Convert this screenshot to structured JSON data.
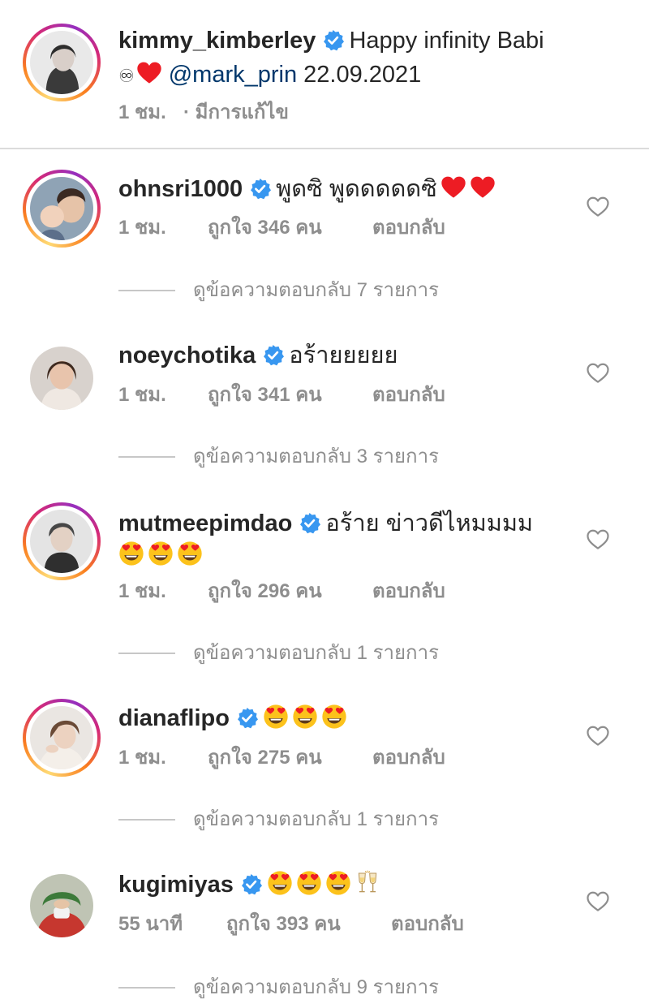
{
  "caption": {
    "username": "kimmy_kimberley",
    "text_line1": "Happy infinity Babi",
    "line2_symbol": "♾",
    "mention": "@mark_prin",
    "date": "22.09.2021",
    "time": "1 ชม.",
    "edited": "· มีการแก้ไข"
  },
  "comments": [
    {
      "username": "ohnsri1000",
      "text": "พูดซิ พูดดดดดซิ",
      "time": "1 ชม.",
      "likes": "ถูกใจ 346 คน",
      "reply": "ตอบกลับ",
      "view_replies": "ดูข้อความตอบกลับ 7 รายการ"
    },
    {
      "username": "noeychotika",
      "text": "อร้ายยยยย",
      "time": "1 ชม.",
      "likes": "ถูกใจ 341 คน",
      "reply": "ตอบกลับ",
      "view_replies": "ดูข้อความตอบกลับ 3 รายการ"
    },
    {
      "username": "mutmeepimdao",
      "text": "อร้าย ข่าวดีไหมมมม",
      "time": "1 ชม.",
      "likes": "ถูกใจ 296 คน",
      "reply": "ตอบกลับ",
      "view_replies": "ดูข้อความตอบกลับ 1 รายการ"
    },
    {
      "username": "dianaflipo",
      "text": "",
      "time": "1 ชม.",
      "likes": "ถูกใจ 275 คน",
      "reply": "ตอบกลับ",
      "view_replies": "ดูข้อความตอบกลับ 1 รายการ"
    },
    {
      "username": "kugimiyas",
      "text": "",
      "time": "55 นาที",
      "likes": "ถูกใจ 393 คน",
      "reply": "ตอบกลับ",
      "view_replies": "ดูข้อความตอบกลับ 9 รายการ"
    }
  ],
  "icons": {
    "verified": "verified-badge-icon",
    "like": "heart-outline-icon",
    "heart_emoji": "red-heart-emoji",
    "heart_eyes_emoji": "heart-eyes-emoji",
    "clinking_glasses_emoji": "clinking-glasses-emoji"
  },
  "colors": {
    "verified_blue": "#3897f0",
    "mention_blue": "#00376b",
    "meta_gray": "#8e8e8e",
    "heart_red": "#ed1c24"
  }
}
